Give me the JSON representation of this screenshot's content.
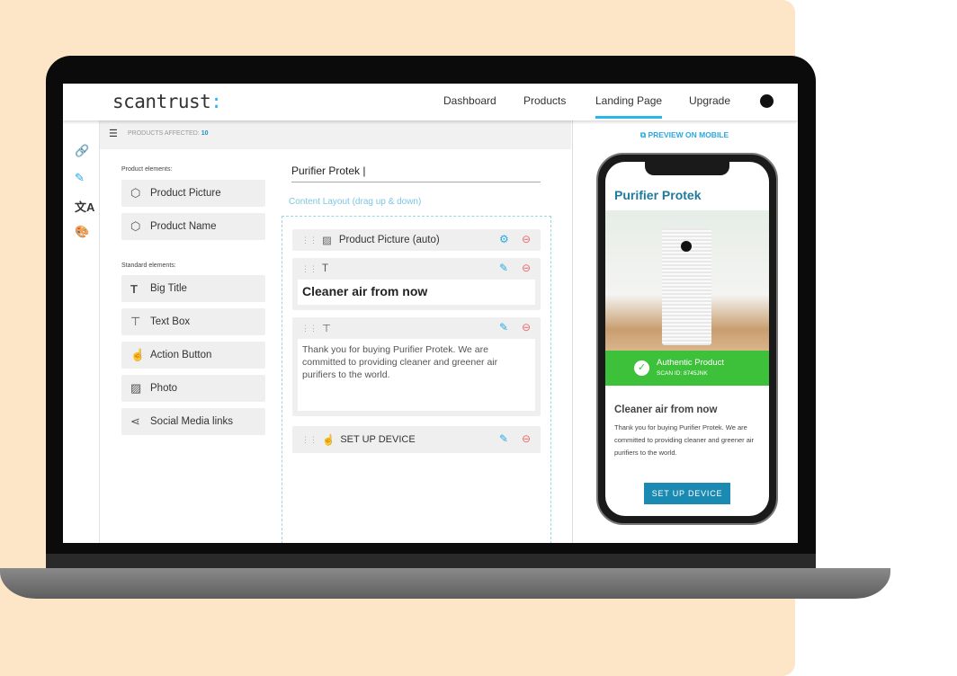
{
  "brand": {
    "name": "scantrust",
    "suffix": ":",
    "accent": "#29b6e8"
  },
  "nav": [
    {
      "label": "Dashboard"
    },
    {
      "label": "Products"
    },
    {
      "label": "Landing Page",
      "active": true
    },
    {
      "label": "Upgrade"
    }
  ],
  "rail_icons": [
    "link-icon",
    "magic-wand-icon",
    "translate-icon",
    "palette-icon"
  ],
  "topbar": {
    "label": "PRODUCTS AFFECTED:",
    "count": "10"
  },
  "product_elements": {
    "label": "Product elements:",
    "items": [
      {
        "label": "Product Picture",
        "icon": "box-icon"
      },
      {
        "label": "Product Name",
        "icon": "box-icon"
      }
    ]
  },
  "standard_elements": {
    "label": "Standard elements:",
    "items": [
      {
        "label": "Big Title",
        "icon": "title-icon"
      },
      {
        "label": "Text Box",
        "icon": "textbox-icon"
      },
      {
        "label": "Action Button",
        "icon": "pointer-icon"
      },
      {
        "label": "Photo",
        "icon": "photo-icon"
      },
      {
        "label": "Social Media links",
        "icon": "share-icon"
      }
    ]
  },
  "editor": {
    "title_value": "Purifier Protek |",
    "layout_label": "Content Layout (drag up & down)",
    "blocks": [
      {
        "label": "Product Picture (auto)"
      },
      {
        "content": "Cleaner air from now"
      },
      {
        "content": "Thank you for buying Purifier Protek. We are committed to providing cleaner and greener air purifiers to the world."
      },
      {
        "label": "SET UP DEVICE"
      }
    ]
  },
  "preview": {
    "link": "PREVIEW ON MOBILE",
    "title": "Purifier Protek",
    "auth_title": "Authentic Product",
    "scan_id": "SCAN ID: 8745JNK",
    "heading": "Cleaner air from now",
    "body": "Thank you for buying Purifier Protek. We are committed to providing cleaner and greener air purifiers to the world.",
    "button": "SET UP DEVICE"
  }
}
